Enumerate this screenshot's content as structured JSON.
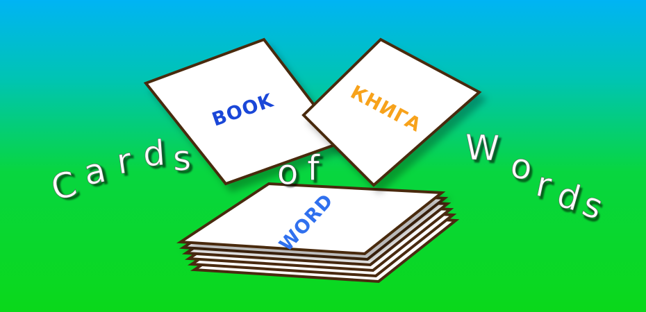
{
  "banner": {
    "title_words": [
      "Cards",
      "of",
      "Words"
    ],
    "cards": {
      "english": {
        "text": "BOOK",
        "color": "#1a47d8"
      },
      "russian": {
        "text": "КНИГА",
        "color": "#f7a21b"
      },
      "stack": {
        "text": "WORD",
        "color": "#3070ee"
      }
    },
    "colors": {
      "sky_top": "#00b4f4",
      "ground": "#0ad81a",
      "card_fill": "#ffffff",
      "card_border": "#4a2a10",
      "title_text": "#ffffff"
    }
  }
}
